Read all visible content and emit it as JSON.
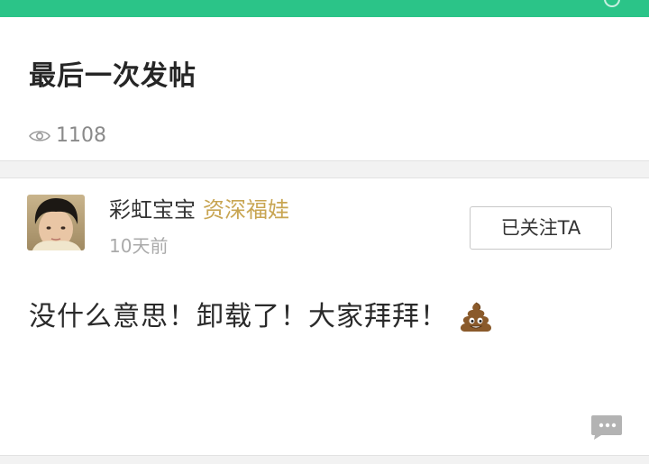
{
  "theme": {
    "accent": "#2bc488",
    "badge_color": "#c8a552",
    "title_color": "#262626",
    "muted_color": "#8a8a8a"
  },
  "post": {
    "title": "最后一次发帖",
    "views_icon": "eye-icon",
    "views": "1108",
    "content": "没什么意思！卸载了！大家拜拜！",
    "content_emoji": "pile-of-poo-icon"
  },
  "author": {
    "name": "彩虹宝宝",
    "badge": "资深福娃",
    "time": "10天前",
    "avatar": "avatar"
  },
  "actions": {
    "follow_label": "已关注TA",
    "comment_icon": "comment-bubble-icon"
  }
}
